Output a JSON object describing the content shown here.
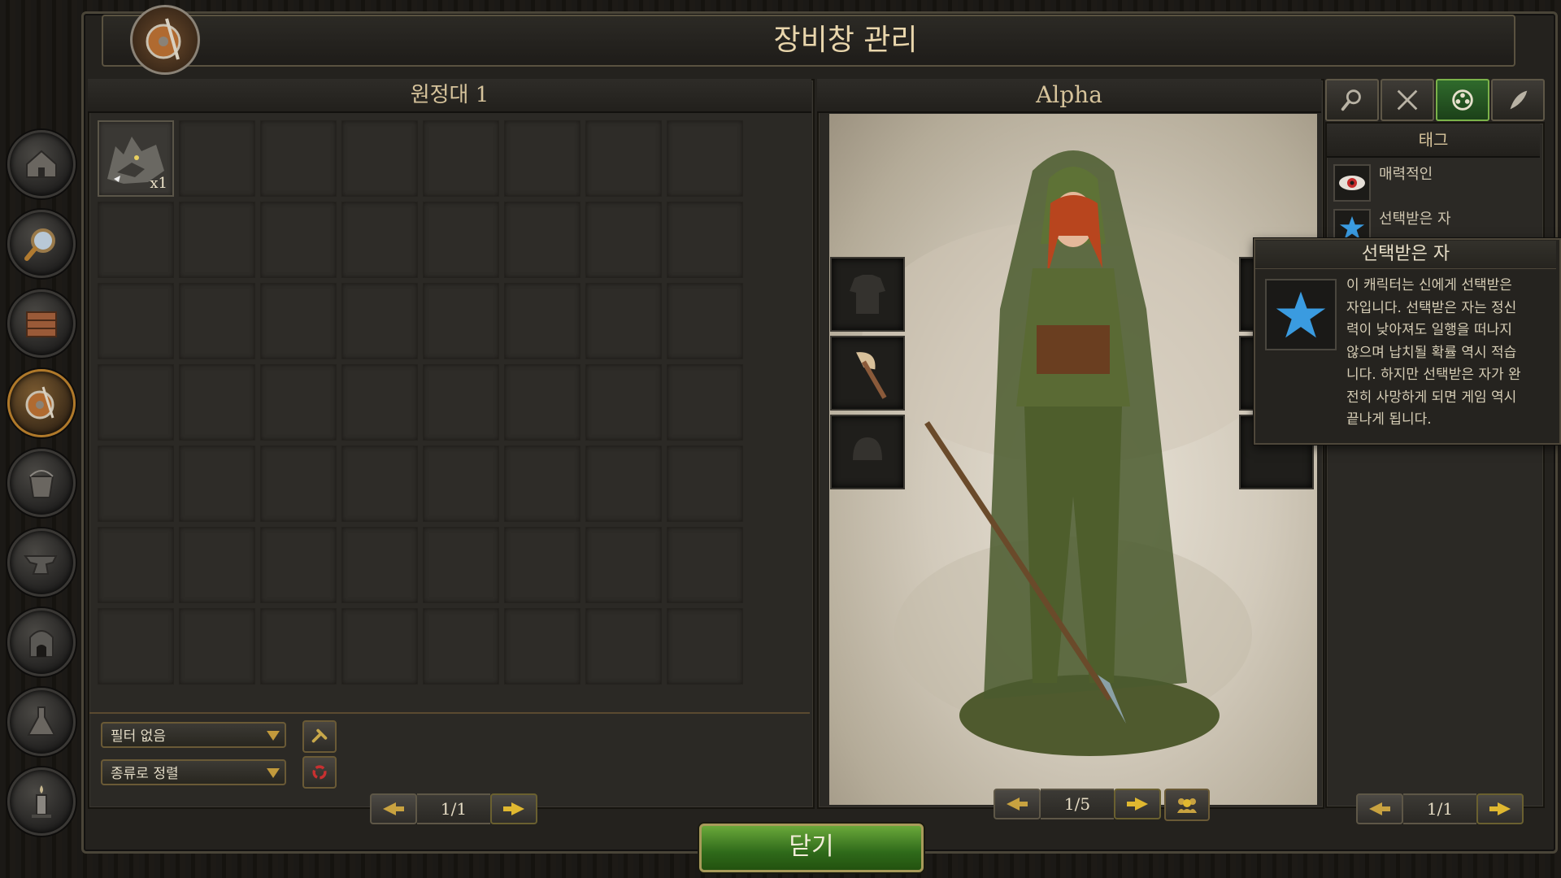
{
  "window": {
    "title": "장비창 관리",
    "close_label": "닫기"
  },
  "sidebar": {
    "items": [
      {
        "name": "house-icon"
      },
      {
        "name": "magnifier-icon"
      },
      {
        "name": "crate-icon"
      },
      {
        "name": "shield-sword-icon",
        "active": true
      },
      {
        "name": "bucket-icon"
      },
      {
        "name": "anvil-icon"
      },
      {
        "name": "furnace-icon"
      },
      {
        "name": "flask-icon"
      },
      {
        "name": "candle-icon"
      }
    ]
  },
  "inventory": {
    "title": "원정대 1",
    "items": [
      {
        "name": "wolf-pelt-icon",
        "qty": "x1"
      }
    ],
    "filter_label": "필터 없음",
    "sort_label": "종류로 정렬",
    "page": "1/1"
  },
  "character": {
    "name": "Alpha",
    "page": "1/5"
  },
  "tabs": [
    {
      "name": "search-tab-icon"
    },
    {
      "name": "crossed-swords-tab-icon"
    },
    {
      "name": "tags-tab-icon",
      "active": true
    },
    {
      "name": "feather-tab-icon"
    }
  ],
  "tags": {
    "title": "태그",
    "list": [
      {
        "label": "매력적인",
        "icon": "eye-icon"
      },
      {
        "label": "선택받은 자",
        "icon": "star-icon"
      }
    ],
    "page": "1/1"
  },
  "tooltip": {
    "title": "선택받은 자",
    "lines": [
      "이 캐릭터는 신에게 선택받은",
      "자입니다. 선택받은 자는 정신",
      "력이 낮아져도 일행을 떠나지",
      "않으며 납치될 확률 역시 적습",
      "니다. 하지만 선택받은 자가 완",
      "전히 사망하게 되면 게임 역시",
      "끝나게 됩니다."
    ]
  },
  "colors": {
    "accent": "#c29a3c",
    "active_tab": "#2f6a2c",
    "close_button": "#4f8a2a",
    "star": "#3a9be0"
  }
}
